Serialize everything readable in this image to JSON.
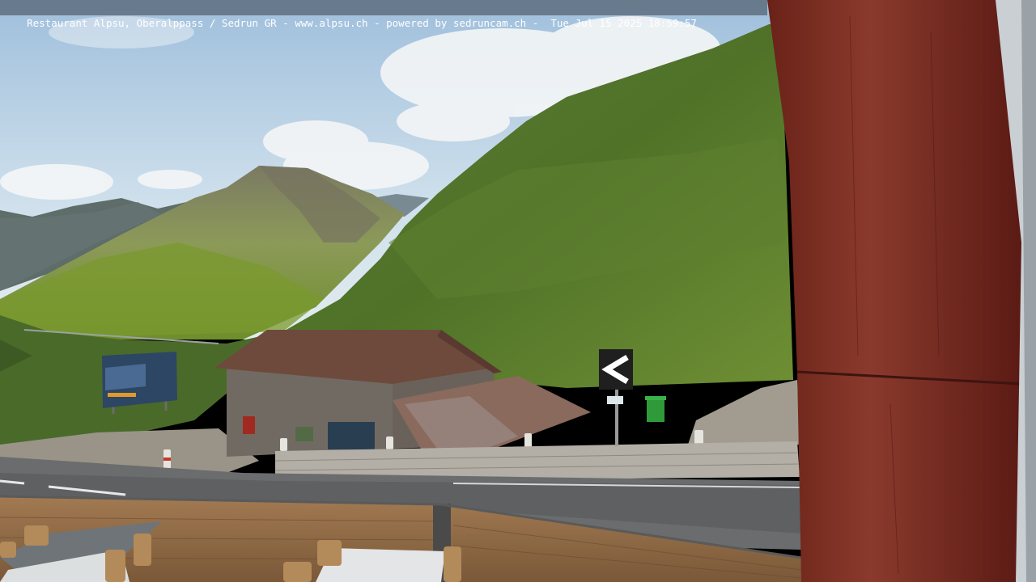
{
  "overlay": {
    "caption": "Restaurant Alpsu, Oberalppass / Sedrun GR - www.alpsu.ch - powered by sedruncam.ch -  Tue Jul 15 2025 18:59:57"
  },
  "scene": {
    "description_colors": {
      "sky": "#c9dcea",
      "meadow": "#5f7d2c",
      "barn_roof": "#6e4a3c",
      "post": "#7a2a20",
      "sign": "#1f1f1f",
      "bin": "#2f9a3a"
    }
  }
}
